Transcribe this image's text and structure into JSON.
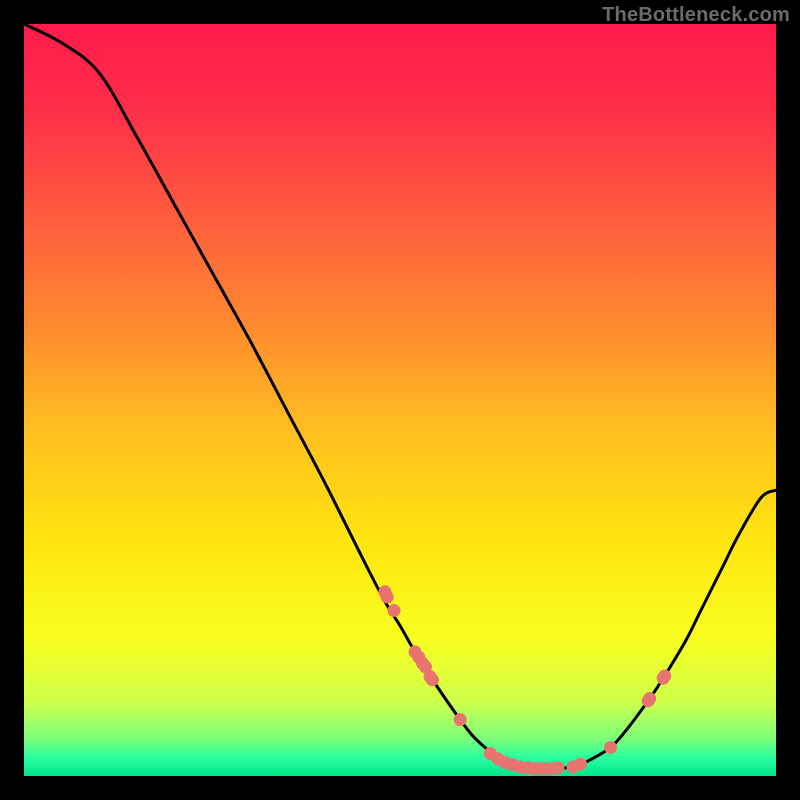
{
  "watermark": "TheBottleneck.com",
  "chart_data": {
    "type": "line",
    "title": "",
    "xlabel": "",
    "ylabel": "",
    "xlim": [
      0,
      100
    ],
    "ylim": [
      0,
      100
    ],
    "grid": false,
    "curve": [
      {
        "x": 0,
        "y": 100
      },
      {
        "x": 5,
        "y": 97.5
      },
      {
        "x": 10,
        "y": 93.5
      },
      {
        "x": 15,
        "y": 85
      },
      {
        "x": 20,
        "y": 76
      },
      {
        "x": 25,
        "y": 67
      },
      {
        "x": 30,
        "y": 58
      },
      {
        "x": 35,
        "y": 48.5
      },
      {
        "x": 40,
        "y": 39
      },
      {
        "x": 45,
        "y": 29
      },
      {
        "x": 48,
        "y": 23.2
      },
      {
        "x": 50,
        "y": 20
      },
      {
        "x": 52,
        "y": 16.5
      },
      {
        "x": 55,
        "y": 11.8
      },
      {
        "x": 58,
        "y": 7.5
      },
      {
        "x": 60,
        "y": 5
      },
      {
        "x": 63,
        "y": 2.5
      },
      {
        "x": 65,
        "y": 1.5
      },
      {
        "x": 67,
        "y": 1
      },
      {
        "x": 70,
        "y": 1
      },
      {
        "x": 73,
        "y": 1.2
      },
      {
        "x": 75,
        "y": 2
      },
      {
        "x": 78,
        "y": 3.8
      },
      {
        "x": 80,
        "y": 6
      },
      {
        "x": 83,
        "y": 10
      },
      {
        "x": 85,
        "y": 13
      },
      {
        "x": 88,
        "y": 18
      },
      {
        "x": 90,
        "y": 22
      },
      {
        "x": 93,
        "y": 28
      },
      {
        "x": 95,
        "y": 32
      },
      {
        "x": 98,
        "y": 37
      },
      {
        "x": 100,
        "y": 38
      }
    ],
    "scatter": [
      {
        "x": 48,
        "y": 24.5
      },
      {
        "x": 48.3,
        "y": 23.8
      },
      {
        "x": 49.2,
        "y": 22
      },
      {
        "x": 52,
        "y": 16.5
      },
      {
        "x": 52.5,
        "y": 15.8
      },
      {
        "x": 53,
        "y": 15
      },
      {
        "x": 53.4,
        "y": 14.5
      },
      {
        "x": 54,
        "y": 13.2
      },
      {
        "x": 54.3,
        "y": 12.8
      },
      {
        "x": 58,
        "y": 7.5
      },
      {
        "x": 62,
        "y": 3
      },
      {
        "x": 63,
        "y": 2.3
      },
      {
        "x": 64,
        "y": 1.8
      },
      {
        "x": 65,
        "y": 1.5
      },
      {
        "x": 66,
        "y": 1.2
      },
      {
        "x": 67,
        "y": 1.1
      },
      {
        "x": 68,
        "y": 1
      },
      {
        "x": 69,
        "y": 1
      },
      {
        "x": 70,
        "y": 1
      },
      {
        "x": 71,
        "y": 1.1
      },
      {
        "x": 73,
        "y": 1.2
      },
      {
        "x": 74,
        "y": 1.6
      },
      {
        "x": 78,
        "y": 3.8
      },
      {
        "x": 83,
        "y": 10
      },
      {
        "x": 83.2,
        "y": 10.3
      },
      {
        "x": 85,
        "y": 13
      },
      {
        "x": 85.2,
        "y": 13.3
      }
    ],
    "gradient_stops": [
      {
        "pos": 0.0,
        "color": "#ff1a4b"
      },
      {
        "pos": 0.12,
        "color": "#ff3049"
      },
      {
        "pos": 0.25,
        "color": "#ff5a3e"
      },
      {
        "pos": 0.4,
        "color": "#ff8a30"
      },
      {
        "pos": 0.55,
        "color": "#ffc21f"
      },
      {
        "pos": 0.7,
        "color": "#ffe80f"
      },
      {
        "pos": 0.82,
        "color": "#f7ff20"
      },
      {
        "pos": 0.9,
        "color": "#cfff4a"
      },
      {
        "pos": 0.95,
        "color": "#7cff78"
      },
      {
        "pos": 0.975,
        "color": "#2bffa0"
      },
      {
        "pos": 1.0,
        "color": "#00e58a"
      }
    ],
    "marker_color": "#e8746f",
    "line_color": "#000000"
  }
}
